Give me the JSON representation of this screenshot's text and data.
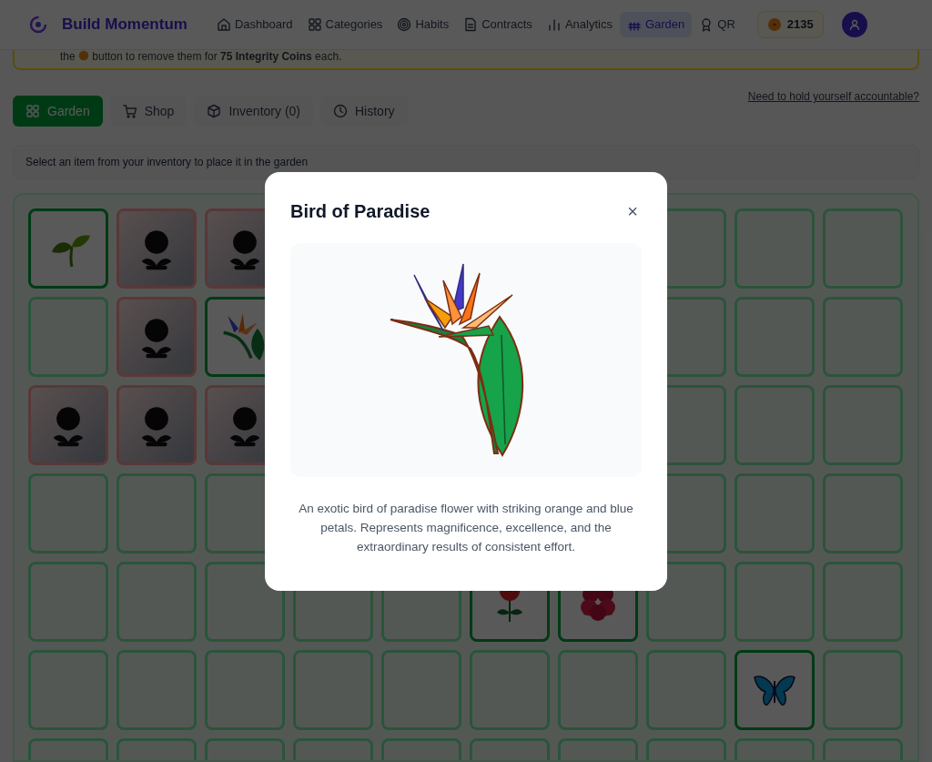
{
  "header": {
    "brand": "Build Momentum",
    "nav": [
      {
        "label": "Dashboard",
        "kind": "home",
        "selected": false
      },
      {
        "label": "Categories",
        "kind": "grid",
        "selected": false
      },
      {
        "label": "Habits",
        "kind": "target",
        "selected": false
      },
      {
        "label": "Contracts",
        "kind": "doc",
        "selected": false
      },
      {
        "label": "Analytics",
        "kind": "bars",
        "selected": false
      },
      {
        "label": "Garden",
        "kind": "fence",
        "selected": true
      },
      {
        "label": "QR",
        "kind": "award",
        "selected": false
      }
    ],
    "coins": "2135"
  },
  "banner": "the button to remove them for **75 Integrity Coins** each.",
  "tabs": [
    {
      "label": "Garden",
      "kind": "grid",
      "selected": true
    },
    {
      "label": "Shop",
      "kind": "cart",
      "selected": false
    },
    {
      "label": "Inventory (0)",
      "kind": "box",
      "selected": false
    },
    {
      "label": "History",
      "kind": "clock",
      "selected": false
    }
  ],
  "accountability_link": "Need to hold yourself accountable?",
  "instruction": "Select an item from your inventory to place it in the garden",
  "garden_rows": [
    {
      "cells": [
        {
          "kind": "sprout"
        },
        {
          "kind": "withered"
        },
        {
          "kind": "withered"
        },
        {
          "kind": "covered"
        },
        {
          "kind": "covered"
        },
        {
          "kind": "covered"
        },
        {
          "kind": "covered"
        },
        {
          "kind": "empty"
        },
        {
          "kind": "empty"
        },
        {
          "kind": "empty"
        }
      ]
    },
    {
      "cells": [
        {
          "kind": "empty"
        },
        {
          "kind": "withered"
        },
        {
          "kind": "bird"
        },
        {
          "kind": "covered"
        },
        {
          "kind": "covered"
        },
        {
          "kind": "covered"
        },
        {
          "kind": "covered"
        },
        {
          "kind": "empty"
        },
        {
          "kind": "empty"
        },
        {
          "kind": "empty"
        }
      ]
    },
    {
      "cells": [
        {
          "kind": "withered"
        },
        {
          "kind": "withered"
        },
        {
          "kind": "withered"
        },
        {
          "kind": "covered"
        },
        {
          "kind": "covered"
        },
        {
          "kind": "covered"
        },
        {
          "kind": "covered"
        },
        {
          "kind": "empty"
        },
        {
          "kind": "empty"
        },
        {
          "kind": "empty"
        }
      ]
    },
    {
      "cells": [
        {
          "kind": "empty"
        },
        {
          "kind": "empty"
        },
        {
          "kind": "empty"
        },
        {
          "kind": "covered"
        },
        {
          "kind": "covered"
        },
        {
          "kind": "covered"
        },
        {
          "kind": "covered"
        },
        {
          "kind": "empty"
        },
        {
          "kind": "empty"
        },
        {
          "kind": "empty"
        }
      ]
    },
    {
      "cells": [
        {
          "kind": "empty"
        },
        {
          "kind": "empty"
        },
        {
          "kind": "empty"
        },
        {
          "kind": "empty"
        },
        {
          "kind": "empty"
        },
        {
          "kind": "poppy"
        },
        {
          "kind": "hibiscus"
        },
        {
          "kind": "empty"
        },
        {
          "kind": "empty"
        },
        {
          "kind": "empty"
        }
      ]
    },
    {
      "cells": [
        {
          "kind": "empty"
        },
        {
          "kind": "empty"
        },
        {
          "kind": "empty"
        },
        {
          "kind": "empty"
        },
        {
          "kind": "empty"
        },
        {
          "kind": "empty"
        },
        {
          "kind": "empty"
        },
        {
          "kind": "empty"
        },
        {
          "kind": "butterfly"
        },
        {
          "kind": "empty"
        }
      ]
    },
    {
      "cells": [
        {
          "kind": "empty"
        },
        {
          "kind": "empty"
        },
        {
          "kind": "empty"
        },
        {
          "kind": "empty"
        },
        {
          "kind": "empty"
        },
        {
          "kind": "empty"
        },
        {
          "kind": "empty"
        },
        {
          "kind": "empty"
        },
        {
          "kind": "empty"
        },
        {
          "kind": "empty"
        }
      ]
    }
  ],
  "modal": {
    "title": "Bird of Paradise",
    "close": "×",
    "description": "An exotic bird of paradise flower with striking orange and blue petals. Represents magnificence, excellence, and the extraordinary results of consistent effort."
  }
}
